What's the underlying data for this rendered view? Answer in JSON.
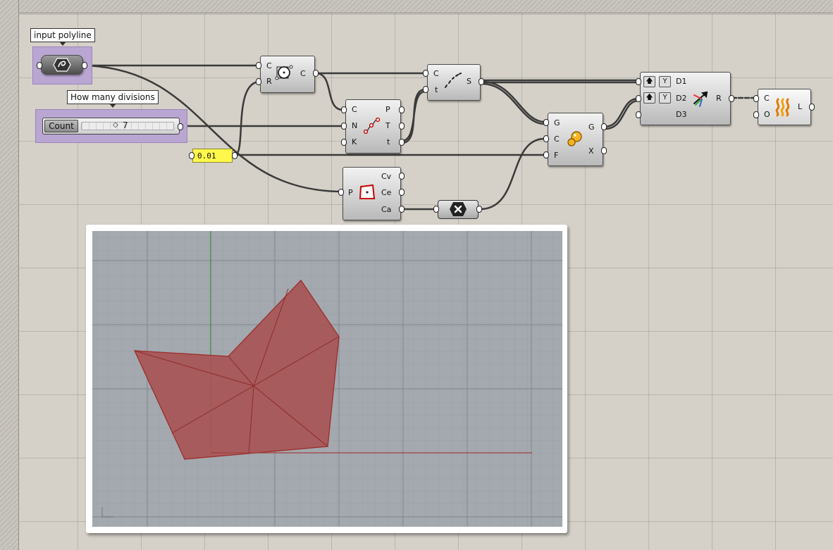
{
  "groups": {
    "polyline_tag": "input polyline",
    "divisions_tag": "How many divisions"
  },
  "slider": {
    "label": "Count",
    "value": "7"
  },
  "panel": {
    "value": "0.01"
  },
  "components": {
    "circle": {
      "inputs": [
        "C",
        "R"
      ],
      "outputs": [
        "C"
      ]
    },
    "divide": {
      "inputs": [
        "C",
        "N",
        "K"
      ],
      "outputs": [
        "P",
        "T",
        "t"
      ]
    },
    "shatter": {
      "inputs": [
        "C",
        "t"
      ],
      "outputs": [
        "S"
      ]
    },
    "area": {
      "inputs": [
        "P"
      ],
      "outputs": [
        "Cv",
        "Ce",
        "Ca"
      ]
    },
    "point_in": {
      "inputs": [
        "G",
        "C",
        "F"
      ],
      "outputs": [
        "G",
        "X"
      ]
    },
    "merge": {
      "inputs": [
        "D1",
        "D2",
        "D3"
      ],
      "outputs": [
        "R"
      ]
    },
    "loft": {
      "inputs": [
        "C",
        "O"
      ],
      "outputs": [
        "L"
      ]
    }
  },
  "icons": {
    "curve_param": "curve-icon",
    "circle": "circle-cnr-icon",
    "divide": "divide-curve-icon",
    "shatter": "shatter-icon",
    "area": "area-icon",
    "negate": "negate-icon",
    "point_in": "point-containment-icon",
    "merge": "merge-icon",
    "loft": "loft-icon"
  },
  "colors": {
    "canvas": "#d5d1c8",
    "group": "#b9a6d2",
    "panel": "#fff84a",
    "viewport": "#a3a9ae",
    "mesh_fill": "#a85555",
    "mesh_edge": "#9c2d2d"
  }
}
